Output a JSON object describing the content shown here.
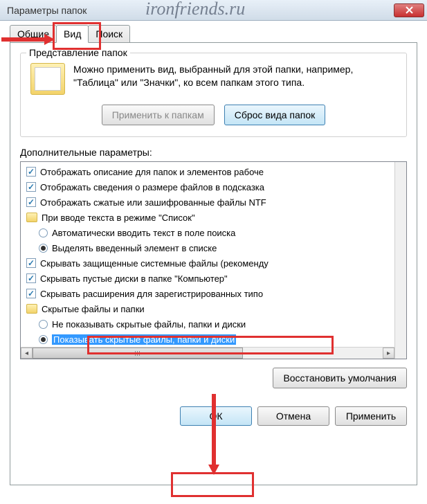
{
  "window": {
    "title": "Параметры папок"
  },
  "watermark": "ironfriends.ru",
  "tabs": {
    "general": "Общие",
    "view": "Вид",
    "search": "Поиск"
  },
  "group": {
    "title": "Представление папок",
    "text": "Можно применить вид, выбранный для этой папки, например, \"Таблица\" или \"Значки\", ко всем папкам этого типа.",
    "apply": "Применить к папкам",
    "reset": "Сброс вида папок"
  },
  "advanced": {
    "title": "Дополнительные параметры:"
  },
  "items": {
    "i0": "Отображать описание для папок и элементов рабоче",
    "i1": "Отображать сведения о размере файлов в подсказка",
    "i2": "Отображать сжатые или зашифрованные файлы NTF",
    "i3": "При вводе текста в режиме \"Список\"",
    "i4": "Автоматически вводить текст в поле поиска",
    "i5": "Выделять введенный элемент в списке",
    "i6": "Скрывать защищенные системные файлы (рекоменду",
    "i7": "Скрывать пустые диски в папке \"Компьютер\"",
    "i8": "Скрывать расширения для зарегистрированных типо",
    "i9": "Скрытые файлы и папки",
    "i10": "Не показывать скрытые файлы, папки и диски",
    "i11": "Показывать скрытые файлы, папки и диски"
  },
  "restore": "Восстановить умолчания",
  "buttons": {
    "ok": "ОК",
    "cancel": "Отмена",
    "apply": "Применить"
  }
}
